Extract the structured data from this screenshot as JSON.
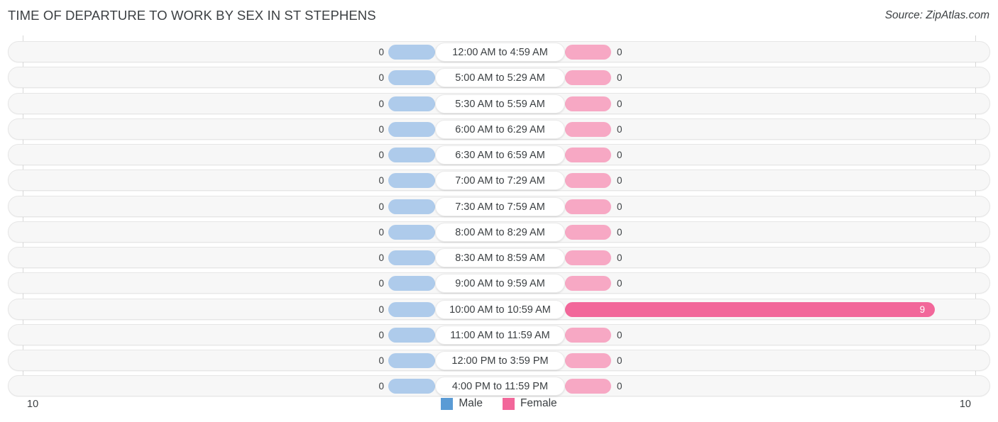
{
  "header": {
    "title": "TIME OF DEPARTURE TO WORK BY SEX IN ST STEPHENS",
    "source": "Source: ZipAtlas.com"
  },
  "axis": {
    "left_label": "10",
    "right_label": "10"
  },
  "legend": {
    "items": [
      {
        "label": "Male",
        "color": "#5a9bd5"
      },
      {
        "label": "Female",
        "color": "#f2679a"
      }
    ]
  },
  "colors": {
    "male_bar": "#aecbeb",
    "female_bar": "#f7a8c4",
    "female_bar_highlight": "#f2679a",
    "row_background": "#f7f7f7",
    "row_border": "#e6e6e6",
    "text": "#3c4043"
  },
  "chart_data": {
    "type": "bar",
    "title": "TIME OF DEPARTURE TO WORK BY SEX IN ST STEPHENS",
    "subtitle": "",
    "orientation": "horizontal-diverging",
    "xlabel": "",
    "ylabel": "",
    "xlim": [
      10,
      10
    ],
    "grid": false,
    "legend_position": "bottom-center",
    "categories": [
      "12:00 AM to 4:59 AM",
      "5:00 AM to 5:29 AM",
      "5:30 AM to 5:59 AM",
      "6:00 AM to 6:29 AM",
      "6:30 AM to 6:59 AM",
      "7:00 AM to 7:29 AM",
      "7:30 AM to 7:59 AM",
      "8:00 AM to 8:29 AM",
      "8:30 AM to 8:59 AM",
      "9:00 AM to 9:59 AM",
      "10:00 AM to 10:59 AM",
      "11:00 AM to 11:59 AM",
      "12:00 PM to 3:59 PM",
      "4:00 PM to 11:59 PM"
    ],
    "series": [
      {
        "name": "Male",
        "values": [
          0,
          0,
          0,
          0,
          0,
          0,
          0,
          0,
          0,
          0,
          0,
          0,
          0,
          0
        ],
        "labels": [
          "0",
          "0",
          "0",
          "0",
          "0",
          "0",
          "0",
          "0",
          "0",
          "0",
          "0",
          "0",
          "0",
          "0"
        ]
      },
      {
        "name": "Female",
        "values": [
          0,
          0,
          0,
          0,
          0,
          0,
          0,
          0,
          0,
          0,
          9,
          0,
          0,
          0
        ],
        "labels": [
          "0",
          "0",
          "0",
          "0",
          "0",
          "0",
          "0",
          "0",
          "0",
          "0",
          "9",
          "0",
          "0",
          "0"
        ]
      }
    ]
  }
}
